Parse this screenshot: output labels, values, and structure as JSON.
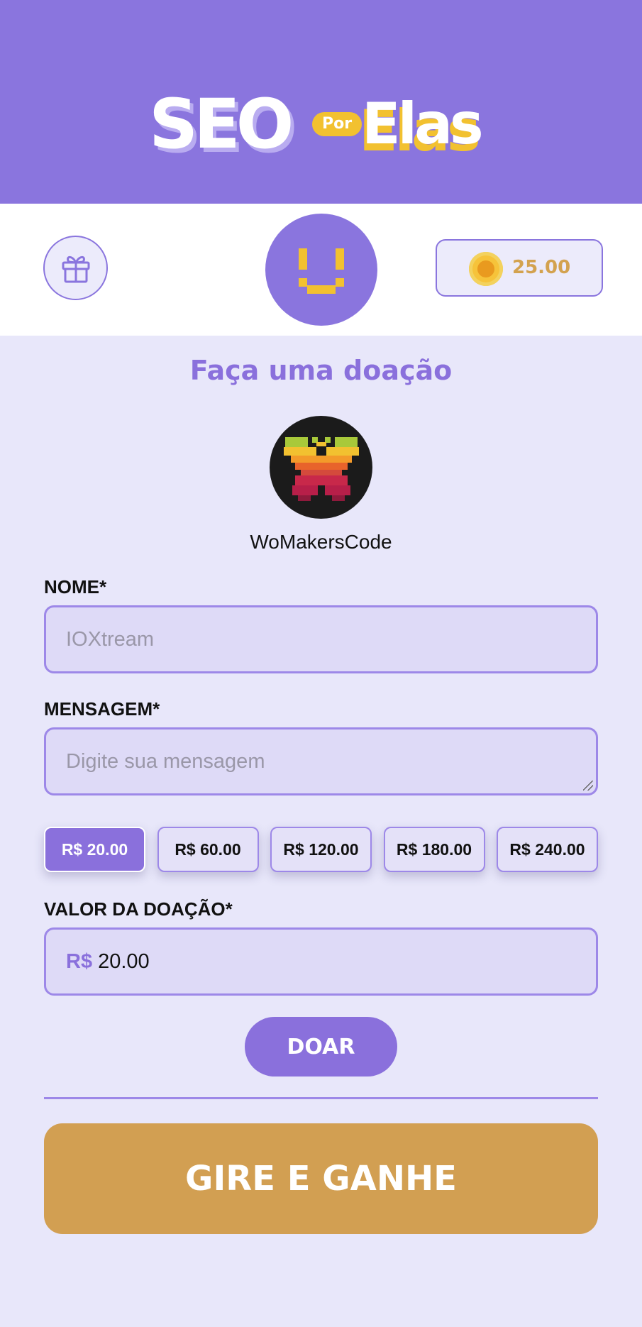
{
  "brand": {
    "logo_main": "SEO",
    "logo_por": "Por",
    "logo_elas": "Elas"
  },
  "topbar": {
    "gift_icon": "gift-icon",
    "avatar_icon": "pixel-smiley-icon",
    "coin_icon": "coin-icon",
    "coin_balance": "25.00"
  },
  "page": {
    "title": "Faça uma doação",
    "creator_name": "WoMakersCode",
    "creator_avatar_icon": "pixel-butterfly-icon"
  },
  "form": {
    "name_label": "NOME*",
    "name_placeholder": "IOXtream",
    "message_label": "MENSAGEM*",
    "message_placeholder": "Digite sua mensagem",
    "amount_options": [
      "R$ 20.00",
      "R$ 60.00",
      "R$ 120.00",
      "R$ 180.00",
      "R$ 240.00"
    ],
    "selected_amount_index": 0,
    "value_label": "VALOR DA DOAÇÃO*",
    "currency_symbol": "R$",
    "value": "20.00",
    "donate_label": "DOAR"
  },
  "spin": {
    "label": "GIRE E GANHE"
  },
  "colors": {
    "accent": "#8a70dc",
    "banner": "#8a75de",
    "gold": "#d29f52",
    "coin": "#f6c33a",
    "background": "#e8e7fa"
  }
}
